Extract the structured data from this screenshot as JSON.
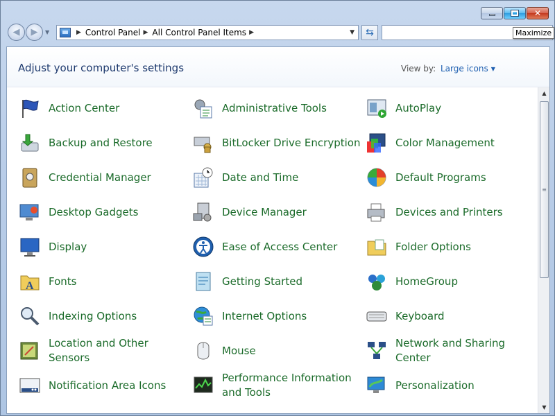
{
  "window": {
    "tooltip": "Maximize"
  },
  "nav": {
    "breadcrumb": [
      "Control Panel",
      "All Control Panel Items"
    ],
    "search_placeholder": ""
  },
  "header": {
    "title": "Adjust your computer's settings",
    "view_by_label": "View by:",
    "view_mode": "Large icons"
  },
  "items": [
    {
      "label": "Action Center",
      "icon": "flag-icon"
    },
    {
      "label": "Administrative Tools",
      "icon": "admin-tools-icon"
    },
    {
      "label": "AutoPlay",
      "icon": "autoplay-icon"
    },
    {
      "label": "Backup and Restore",
      "icon": "backup-icon"
    },
    {
      "label": "BitLocker Drive Encryption",
      "icon": "bitlocker-icon"
    },
    {
      "label": "Color Management",
      "icon": "color-management-icon"
    },
    {
      "label": "Credential Manager",
      "icon": "credential-manager-icon"
    },
    {
      "label": "Date and Time",
      "icon": "calendar-clock-icon"
    },
    {
      "label": "Default Programs",
      "icon": "default-programs-icon"
    },
    {
      "label": "Desktop Gadgets",
      "icon": "desktop-gadgets-icon"
    },
    {
      "label": "Device Manager",
      "icon": "device-manager-icon"
    },
    {
      "label": "Devices and Printers",
      "icon": "printer-icon"
    },
    {
      "label": "Display",
      "icon": "monitor-icon"
    },
    {
      "label": "Ease of Access Center",
      "icon": "ease-of-access-icon"
    },
    {
      "label": "Folder Options",
      "icon": "folder-icon"
    },
    {
      "label": "Fonts",
      "icon": "fonts-folder-icon"
    },
    {
      "label": "Getting Started",
      "icon": "getting-started-icon"
    },
    {
      "label": "HomeGroup",
      "icon": "homegroup-icon"
    },
    {
      "label": "Indexing Options",
      "icon": "indexing-icon"
    },
    {
      "label": "Internet Options",
      "icon": "globe-icon"
    },
    {
      "label": "Keyboard",
      "icon": "keyboard-icon"
    },
    {
      "label": "Location and Other Sensors",
      "icon": "sensors-icon"
    },
    {
      "label": "Mouse",
      "icon": "mouse-icon"
    },
    {
      "label": "Network and Sharing Center",
      "icon": "network-icon"
    },
    {
      "label": "Notification Area Icons",
      "icon": "notification-area-icon"
    },
    {
      "label": "Performance Information and Tools",
      "icon": "performance-icon"
    },
    {
      "label": "Personalization",
      "icon": "personalization-icon"
    }
  ]
}
